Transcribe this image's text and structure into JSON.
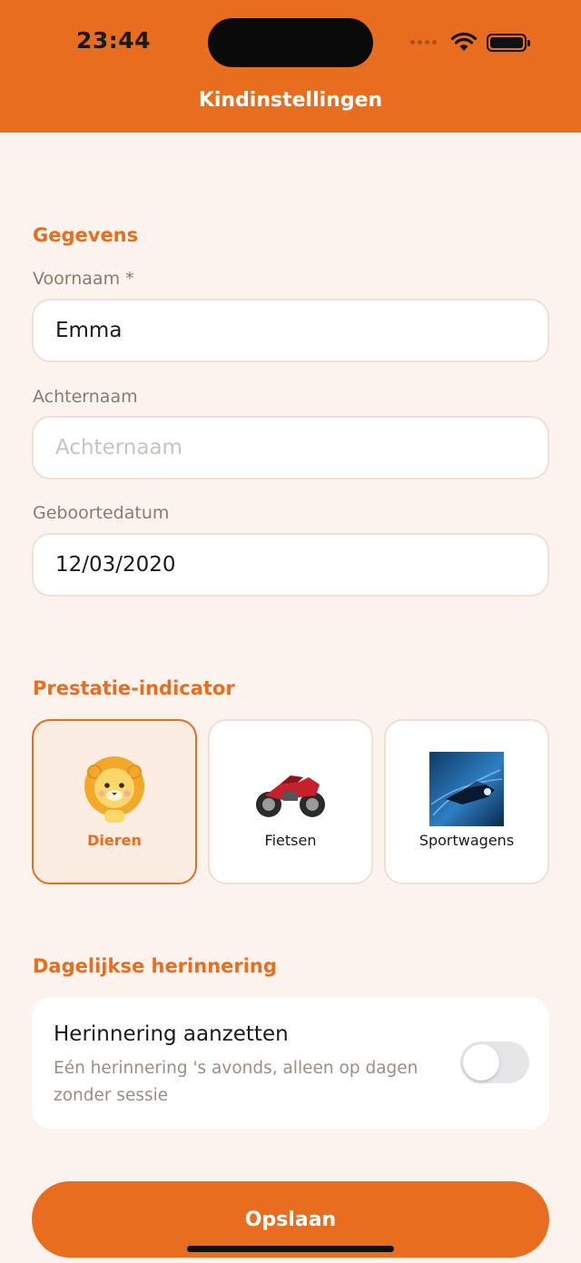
{
  "status_bar": {
    "time": "23:44"
  },
  "header": {
    "title": "Kindinstellingen"
  },
  "details": {
    "section_title": "Gegevens",
    "first_name": {
      "label": "Voornaam *",
      "value": "Emma"
    },
    "last_name": {
      "label": "Achternaam",
      "value": "",
      "placeholder": "Achternaam"
    },
    "birth_date": {
      "label": "Geboortedatum",
      "value": "12/03/2020"
    }
  },
  "indicator": {
    "section_title": "Prestatie-indicator",
    "options": [
      {
        "label": "Dieren",
        "icon": "lion-icon",
        "selected": true
      },
      {
        "label": "Fietsen",
        "icon": "motorcycle-icon",
        "selected": false
      },
      {
        "label": "Sportwagens",
        "icon": "sportscar-icon",
        "selected": false
      }
    ]
  },
  "reminder": {
    "section_title": "Dagelijkse herinnering",
    "title": "Herinnering aanzetten",
    "description": "Eén herinnering 's avonds, alleen op dagen zonder sessie",
    "enabled": false
  },
  "save_button": {
    "label": "Opslaan"
  },
  "colors": {
    "accent": "#E86D1E",
    "background": "#FDF3EE",
    "card_border": "#F2DED2",
    "toggle_off": "#E6E6E8"
  }
}
